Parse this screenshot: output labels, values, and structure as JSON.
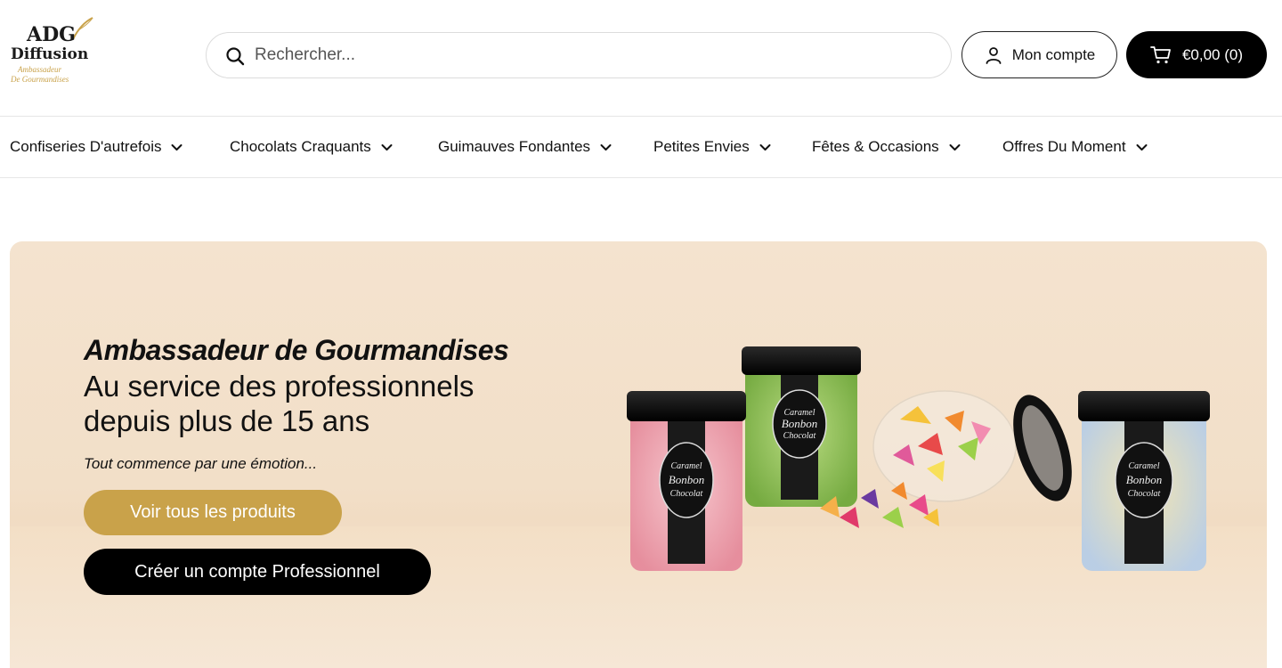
{
  "logo": {
    "line1": "ADG",
    "line2": "Diffusion",
    "line3": "Ambassadeur",
    "line4": "De Gourmandises"
  },
  "search": {
    "placeholder": "Rechercher..."
  },
  "header": {
    "account_label": "Mon compte",
    "cart_label": "€0,00 (0)"
  },
  "nav": {
    "items": [
      {
        "label": "Confiseries D'autrefois"
      },
      {
        "label": "Chocolats Craquants"
      },
      {
        "label": "Guimauves Fondantes"
      },
      {
        "label": "Petites Envies"
      },
      {
        "label": "Fêtes & Occasions"
      },
      {
        "label": "Offres Du Moment"
      }
    ]
  },
  "hero": {
    "kicker": "Ambassadeur de Gourmandises",
    "title_line1": "Au service des professionnels",
    "title_line2": "depuis plus de 15 ans",
    "tagline": "Tout commence par une émotion...",
    "cta_primary": "Voir tous les produits",
    "cta_secondary": "Créer un compte Professionnel",
    "jar_label": [
      "Caramel",
      "Bonbon",
      "&",
      "Chocolat"
    ]
  },
  "colors": {
    "accent_gold": "#c9a24a",
    "black": "#000000",
    "hero_bg": "#f4e3cf"
  }
}
